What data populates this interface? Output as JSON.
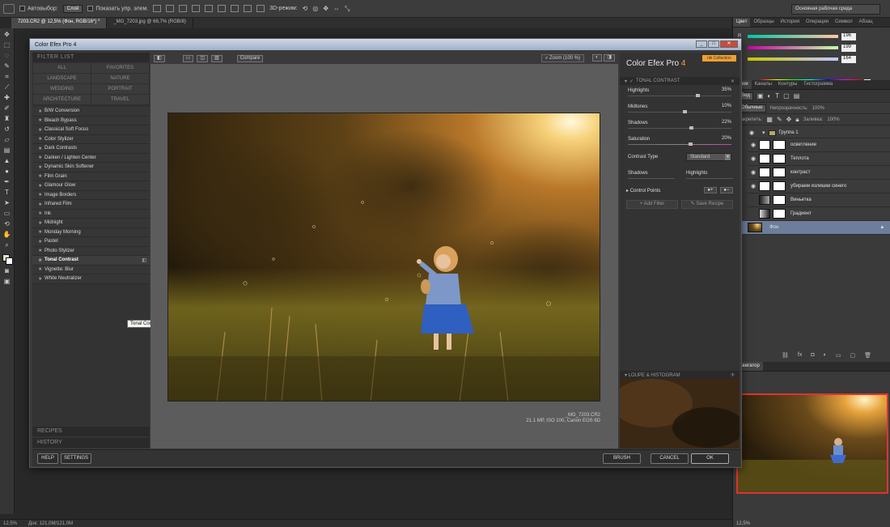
{
  "optbar": {
    "autoselect_label": "Автовыбор:",
    "autoselect_value": "Слой",
    "show_controls_label": "Показать упр. элем.",
    "mode_3d_label": "3D-режим:",
    "workspace": "Основная рабочая среда"
  },
  "doc_tabs": [
    "7203.CR2 @ 12,5% (Фон, RGB/16*) *",
    "_MG_7203.jpg @ 66,7% (RGB/8)"
  ],
  "statusbar": {
    "zoom": "12,5%",
    "doc": "Док: 121,0M/121,0M",
    "nav_zoom": "12,5%"
  },
  "color_panel": {
    "tabs": [
      "Цвет",
      "Образцы",
      "История",
      "Операции",
      "Символ",
      "Абзац"
    ],
    "channels": [
      {
        "label": "R",
        "value": "196"
      },
      {
        "label": "G",
        "value": "199"
      },
      {
        "label": "B",
        "value": "164"
      }
    ]
  },
  "layers_panel": {
    "tabs": [
      "Слои",
      "Каналы",
      "Контуры",
      "Гистограмма"
    ],
    "kind_select": "Вид",
    "blend_mode": "Обычные",
    "opacity_label": "Непрозрачность:",
    "opacity_value": "100%",
    "lock_label": "Закрепить:",
    "fill_label": "Заливка:",
    "fill_value": "100%",
    "group_name": "Группа 1",
    "layers": [
      {
        "name": "осветление"
      },
      {
        "name": "Теплота"
      },
      {
        "name": "контраст"
      },
      {
        "name": "убираем излишки синего"
      },
      {
        "name": "Виньетка"
      },
      {
        "name": "Градиент"
      },
      {
        "name": "Фон"
      }
    ]
  },
  "navigator": {
    "title": "Навигатор"
  },
  "cef": {
    "window_title": "Color Efex Pro 4",
    "filterlist_label": "FILTER LIST",
    "categories": [
      "ALL",
      "FAVORITES",
      "LANDSCAPE",
      "NATURE",
      "WEDDING",
      "PORTRAIT",
      "ARCHITECTURE",
      "TRAVEL"
    ],
    "filters": [
      "B/W Conversion",
      "Bleach Bypass",
      "Classical Soft Focus",
      "Color Stylizer",
      "Dark Contrasts",
      "Darken / Lighten Center",
      "Dynamic Skin Softener",
      "Film Grain",
      "Glamour Glow",
      "Image Borders",
      "Infrared Film",
      "Ink",
      "Midnight",
      "Monday Morning",
      "Pastel",
      "Photo Stylizer",
      "Tonal Contrast",
      "Vignette: Blur",
      "White Neutralizer"
    ],
    "tooltip": "Tonal Contrast",
    "recipes_label": "RECIPES",
    "history_label": "HISTORY",
    "compare_label": "Compare",
    "zoom_label": "Zoom (100 %)",
    "photo_filename": "_MG_7203.CR2",
    "photo_info": "21.1 MP, ISO 100, Canon EOS 6D",
    "logo_text": "Color Efex Pro ",
    "logo_version": "4",
    "badge": "nik Collection",
    "section_title": "TONAL CONTRAST",
    "sliders": [
      {
        "label": "Highlights",
        "value": "35%",
        "pos": 0.35
      },
      {
        "label": "Midtones",
        "value": "10%",
        "pos": 0.1
      },
      {
        "label": "Shadows",
        "value": "22%",
        "pos": 0.22
      },
      {
        "label": "Saturation",
        "value": "20%",
        "pos": 0.2
      }
    ],
    "contrast_type_label": "Contrast Type",
    "contrast_type_value": "Standard",
    "shadows_label": "Shadows",
    "highlights_label": "Highlights",
    "control_points_label": "Control Points",
    "add_filter": "Add Filter",
    "save_recipe": "Save Recipe",
    "loupe_label": "LOUPE & HISTOGRAM",
    "help": "HELP",
    "settings": "SETTINGS",
    "brush": "BRUSH",
    "cancel": "CANCEL",
    "ok": "OK",
    "accent": "#f2a72f"
  }
}
